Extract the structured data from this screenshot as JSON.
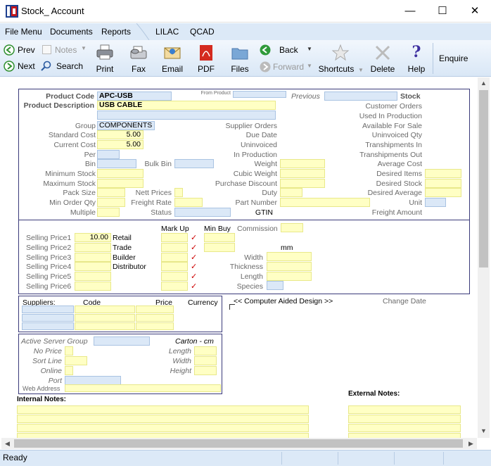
{
  "window": {
    "title": "Stock_ Account"
  },
  "menu": {
    "items": [
      "File Menu",
      "Documents",
      "Reports",
      "LILAC",
      "QCAD"
    ]
  },
  "toolbar": {
    "prev": "Prev",
    "next": "Next",
    "notes": "Notes",
    "search": "Search",
    "print": "Print",
    "fax": "Fax",
    "email": "Email",
    "pdf": "PDF",
    "files": "Files",
    "back": "Back",
    "forward": "Forward",
    "shortcuts": "Shortcuts",
    "delete": "Delete",
    "help": "Help",
    "enquire": "Enquire"
  },
  "product": {
    "code_label": "Product Code",
    "code": "APC-USB",
    "desc_label": "Product Description",
    "desc": "USB CABLE",
    "from_product": "From Product",
    "previous": "Previous",
    "stock": "Stock",
    "group_label": "Group",
    "group": "COMPONENTS",
    "std_cost_label": "Standard Cost",
    "std_cost": "5.00",
    "cur_cost_label": "Current Cost",
    "cur_cost": "5.00",
    "per": "Per",
    "bin": "Bin",
    "bulk_bin": "Bulk Bin",
    "min_stock": "Minimum Stock",
    "max_stock": "Maximum Stock",
    "pack_size": "Pack Size",
    "nett_prices": "Nett Prices",
    "min_order_qty": "Min Order Qty",
    "freight_rate": "Freight Rate",
    "multiple": "Multiple",
    "status": "Status"
  },
  "middle": {
    "supplier_orders": "Supplier Orders",
    "due_date": "Due Date",
    "uninvoiced": "Uninvoiced",
    "in_production": "In Production",
    "weight": "Weight",
    "cubic_weight": "Cubic Weight",
    "purchase_discount": "Purchase Discount",
    "duty": "Duty",
    "part_number": "Part Number",
    "gtin": "GTIN"
  },
  "right": {
    "customer_orders": "Customer Orders",
    "used_in_production": "Used In Production",
    "available_for_sale": "Available For Sale",
    "uninvoiced_qty": "Uninvoiced Qty",
    "transhipments_in": "Transhipments In",
    "transhipments_out": "Transhipments Out",
    "average_cost": "Average Cost",
    "desired_items": "Desired Items",
    "desired_stock": "Desired Stock",
    "desired_average": "Desired Average",
    "unit": "Unit",
    "freight_amount": "Freight Amount"
  },
  "pricing": {
    "mark_up": "Mark Up",
    "min_buy": "Min Buy",
    "commission": "Commission",
    "prices": [
      {
        "label": "Selling Price1",
        "value": "10.00",
        "type": "Retail"
      },
      {
        "label": "Selling Price2",
        "value": "",
        "type": "Trade"
      },
      {
        "label": "Selling Price3",
        "value": "",
        "type": "Builder"
      },
      {
        "label": "Selling Price4",
        "value": "",
        "type": "Distributor"
      },
      {
        "label": "Selling Price5",
        "value": "",
        "type": ""
      },
      {
        "label": "Selling Price6",
        "value": "",
        "type": ""
      }
    ],
    "tick": "✓",
    "mm": "mm",
    "width": "Width",
    "thickness": "Thickness",
    "length": "Length",
    "species": "Species"
  },
  "suppliers": {
    "col_suppliers": "Suppliers:",
    "col_code": "Code",
    "col_price": "Price",
    "col_currency": "Currency"
  },
  "cad": {
    "link": "<< Computer Aided Design >>",
    "change_date": "Change Date"
  },
  "web": {
    "active_server_group": "Active Server Group",
    "carton": "Carton - cm",
    "no_price": "No Price",
    "sort_line": "Sort Line",
    "online": "Online",
    "port": "Port",
    "web_address": "Web Address",
    "length": "Length",
    "width": "Width",
    "height": "Height"
  },
  "notes": {
    "internal": "Internal Notes:",
    "external": "External Notes:"
  },
  "status": {
    "text": "Ready"
  }
}
